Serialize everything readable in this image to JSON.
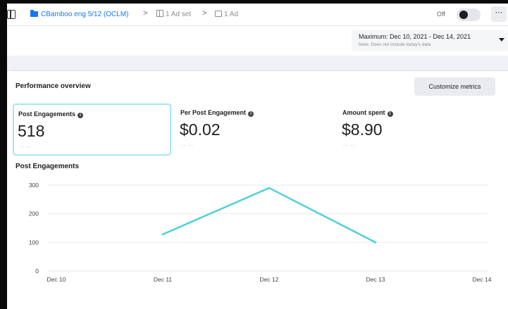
{
  "breadcrumb": {
    "campaign": "CBamboo eng 5/12 (OCLM)",
    "ad_set": "1 Ad set",
    "ad": "1 Ad",
    "separator": ">"
  },
  "status": {
    "toggle_label": "Off",
    "toggle_on": false,
    "more_label": "⋯"
  },
  "date_range": {
    "label": "Maximum: Dec 10, 2021 - Dec 14, 2021",
    "note": "Note: Does not include today's data"
  },
  "overview": {
    "title": "Performance overview",
    "customize_label": "Customize metrics",
    "metrics": [
      {
        "label": "Post Engagements",
        "value": "518",
        "sub": "-- --",
        "selected": true
      },
      {
        "label": "Per Post Engagement",
        "value": "$0.02",
        "sub": "-- --",
        "selected": false
      },
      {
        "label": "Amount spent",
        "value": "$8.90",
        "sub": "-- --",
        "selected": false
      }
    ]
  },
  "chart_data": {
    "type": "line",
    "title": "Post Engagements",
    "categories": [
      "Dec 10",
      "Dec 11",
      "Dec 12",
      "Dec 13",
      "Dec 14"
    ],
    "series": [
      {
        "values": [
          null,
          128,
          290,
          100,
          null
        ],
        "color": "#4fd1d9"
      }
    ],
    "y_ticks": [
      "0",
      "100",
      "200",
      "300"
    ],
    "ylim": [
      0,
      300
    ],
    "grid": true
  }
}
